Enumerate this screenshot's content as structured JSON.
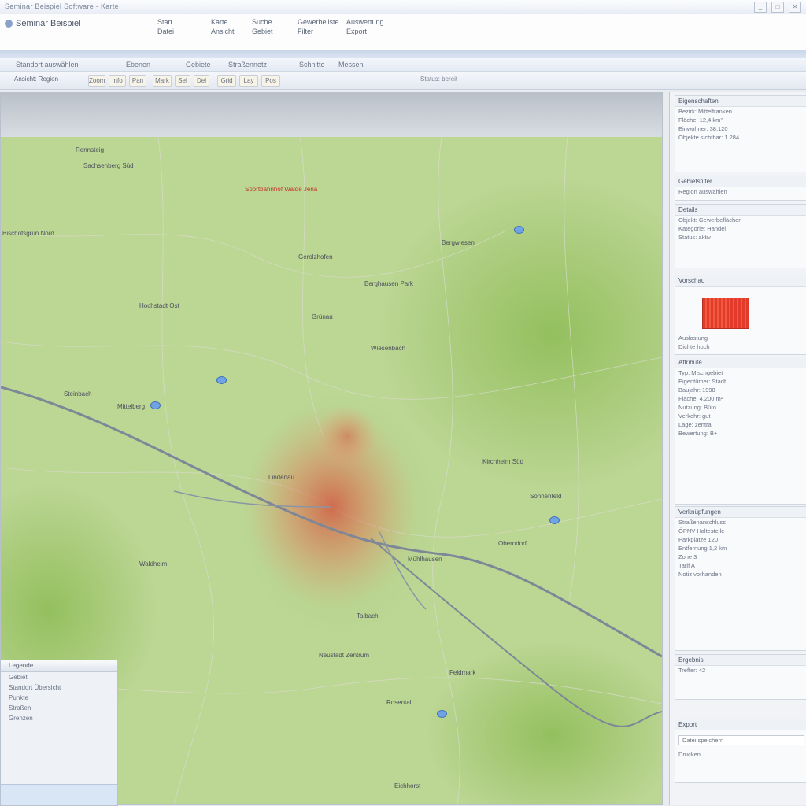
{
  "window": {
    "title": "Seminar Beispiel Software - Karte",
    "controls": [
      "_",
      "□",
      "✕"
    ]
  },
  "ribbon": {
    "app_name": "Seminar Beispiel",
    "groups": [
      {
        "l1": "Start",
        "l2": "Datei"
      },
      {
        "l1": "Karte",
        "l2": "Ansicht"
      },
      {
        "l1": "Suche",
        "l2": "Gebiet"
      },
      {
        "l1": "Gewerbeliste",
        "l2": "Filter"
      },
      {
        "l1": "Auswertung",
        "l2": "Export"
      }
    ]
  },
  "toolbar1": [
    "Standort auswählen",
    "Ebenen",
    "Gebiete",
    "Straßennetz",
    "Schnitte",
    "Messen"
  ],
  "toolbar2": {
    "left": "Ansicht: Region",
    "buttons": [
      "Zoom",
      "Info",
      "Pan",
      "Mark",
      "Sel",
      "Del",
      "Grid",
      "Lay",
      "Pos"
    ],
    "right": "Status: bereit"
  },
  "map": {
    "labels": [
      {
        "t": "Rennsteig",
        "red": false
      },
      {
        "t": "Sachsenberg Süd",
        "red": false
      },
      {
        "t": "Sportbahnhof Walde Jena",
        "red": true
      },
      {
        "t": "Bischofsgrün Nord",
        "red": false
      },
      {
        "t": "Gerolzhofen",
        "red": false
      },
      {
        "t": "Bergwiesen",
        "red": false
      },
      {
        "t": "Berghausen Park",
        "red": false
      },
      {
        "t": "Hochstadt Ost",
        "red": false
      },
      {
        "t": "Grünau",
        "red": false
      },
      {
        "t": "Wiesenbach",
        "red": false
      },
      {
        "t": "Steinbach",
        "red": false
      },
      {
        "t": "Mittelberg",
        "red": false
      },
      {
        "t": "Kirchheim Süd",
        "red": false
      },
      {
        "t": "Lindenau",
        "red": false
      },
      {
        "t": "Sonnenfeld",
        "red": false
      },
      {
        "t": "Oberndorf",
        "red": false
      },
      {
        "t": "Mühlhausen",
        "red": false
      },
      {
        "t": "Waldheim",
        "red": false
      },
      {
        "t": "Talbach",
        "red": false
      },
      {
        "t": "Neustadt Zentrum",
        "red": false
      },
      {
        "t": "Feldmark",
        "red": false
      },
      {
        "t": "Rosental",
        "red": false
      },
      {
        "t": "Eichhorst",
        "red": false
      }
    ]
  },
  "legend": {
    "title": "Legende",
    "rows": [
      "Gebiet",
      "Standort Übersicht",
      "Punkte",
      "Straßen",
      "Grenzen"
    ]
  },
  "panel": {
    "sections": [
      {
        "title": "Eigenschaften",
        "rows": [
          "Bezirk: Mittelfranken",
          "Fläche: 12,4 km²",
          "Einwohner: 38.120",
          "Objekte sichtbar: 1.284"
        ]
      },
      {
        "title": "Gebietsfilter",
        "rows": [
          "Region auswählen"
        ]
      },
      {
        "title": "Details",
        "rows": [
          "Objekt: Gewerbeflächen",
          "Kategorie: Handel",
          "Status: aktiv"
        ]
      },
      {
        "title": "Vorschau",
        "rows": [
          "Auslastung",
          "Dichte hoch"
        ]
      },
      {
        "title": "Attribute",
        "rows": [
          "Typ: Mischgebiet",
          "Eigentümer: Stadt",
          "Baujahr: 1998",
          "Fläche: 4.200 m²",
          "Nutzung: Büro",
          "Verkehr: gut",
          "Lage: zentral",
          "Bewertung: B+"
        ]
      },
      {
        "title": "Verknüpfungen",
        "rows": [
          "Straßenanschluss",
          "ÖPNV Haltestelle",
          "Parkplätze 120",
          "Entfernung 1,2 km",
          "Zone 3",
          "Tarif A",
          "Notiz vorhanden"
        ]
      },
      {
        "title": "Ergebnis",
        "rows": [
          "Treffer: 42"
        ]
      },
      {
        "title": "Export",
        "rows": [
          "Datei speichern",
          "Drucken"
        ]
      }
    ]
  },
  "colors": {
    "map_green": "#b9d58f",
    "road": "#6f7c8e",
    "dense_area": "#d94a3a",
    "pin": "#6fa3e4",
    "thumb": "#e23b2c"
  }
}
